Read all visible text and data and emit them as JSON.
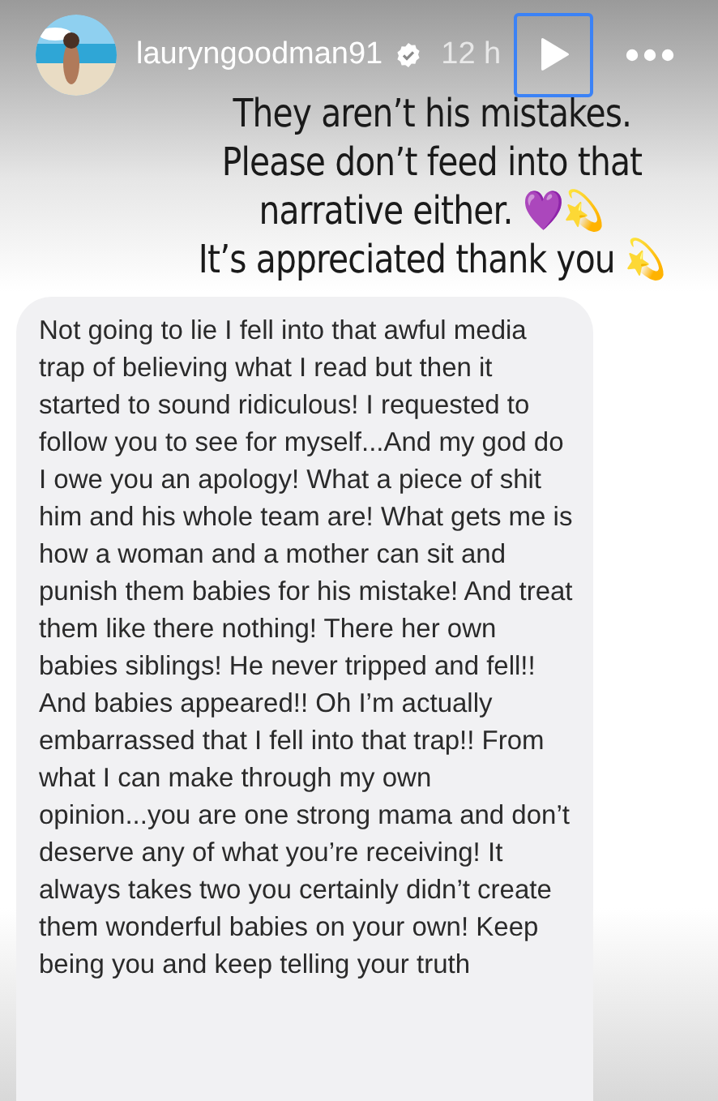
{
  "header": {
    "username": "lauryngoodman91",
    "verified": true,
    "time": "12 h",
    "play_button": {
      "focused": true
    }
  },
  "caption_lines": [
    "They aren’t his mistakes.",
    "Please don’t feed into that",
    "narrative either. 💜💫",
    "It’s appreciated thank you 💫"
  ],
  "message": {
    "text": "Not going to lie I fell into that awful media trap of believing what I read but then it started to sound ridiculous! I requested to follow you to see for myself...And my god do I owe you an apology! What a piece of shit him and his whole team are! What gets me is how a woman and a mother can sit and punish them babies for his mistake!  And treat them like there nothing! There her own babies siblings! He never tripped and fell!! And babies appeared!! Oh I’m actually embarrassed that I fell into that trap!! From what I can make through my own opinion...you are one strong mama and don’t deserve any of what you’re receiving! It always takes two you certainly didn’t create them wonderful babies on your own! Keep being you and keep telling your truth"
  }
}
